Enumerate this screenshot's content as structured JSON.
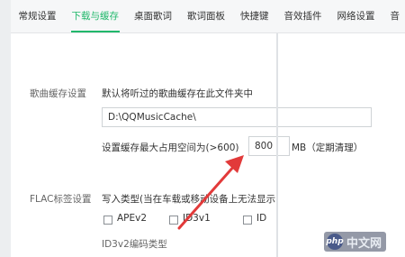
{
  "tabs": [
    {
      "label": "常规设置"
    },
    {
      "label": "下载与缓存"
    },
    {
      "label": "桌面歌词"
    },
    {
      "label": "歌词面板"
    },
    {
      "label": "快捷键"
    },
    {
      "label": "音效插件"
    },
    {
      "label": "网络设置"
    },
    {
      "label": "音"
    }
  ],
  "active_tab": "下载与缓存",
  "cache": {
    "section_label": "歌曲缓存设置",
    "description": "默认将听过的歌曲缓存在此文件夹中",
    "path_value": "D:\\QQMusicCache\\",
    "max_label": "设置缓存最大占用空间为(>600)",
    "max_value": "800",
    "unit_label": "MB（定期清理）"
  },
  "flac": {
    "section_label": "FLAC标签设置",
    "write_type_label": "写入类型(当在车载或移动设备上无法显示",
    "options": [
      {
        "label": "APEv2",
        "checked": false
      },
      {
        "label": "ID3v1",
        "checked": false
      },
      {
        "label": "ID",
        "checked": false
      }
    ],
    "id3v2_label": "ID3v2编码类型"
  },
  "watermark": {
    "logo": "php",
    "text": "中文网"
  },
  "accent_color": "#21b86b",
  "arrow_color": "#e23a3a"
}
